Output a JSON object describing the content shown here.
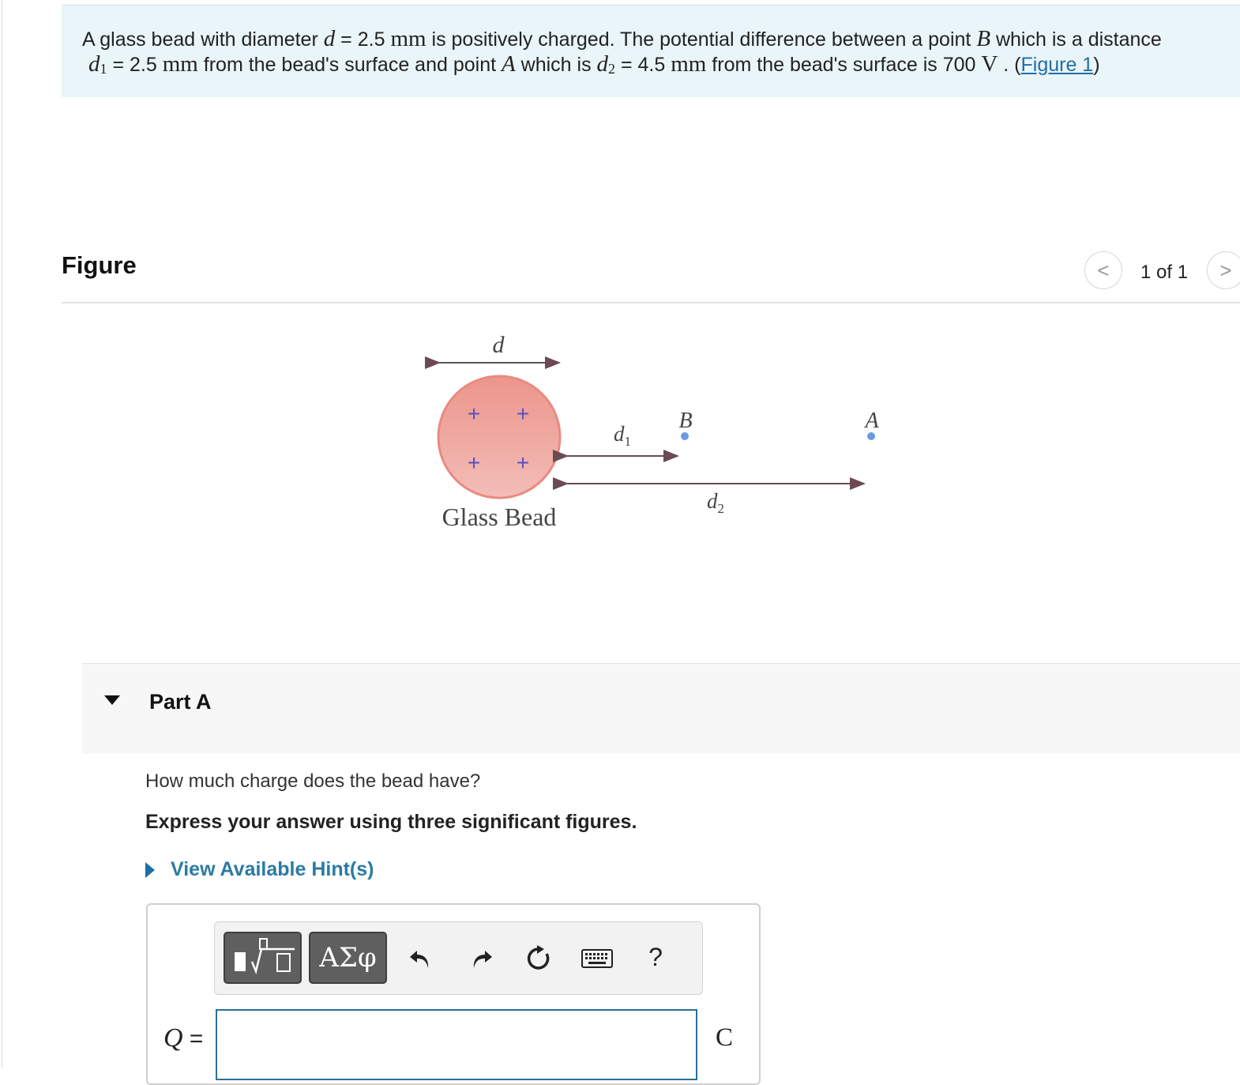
{
  "problem": {
    "p1": "A glass bead with diameter ",
    "d_sym": "d",
    "eq": " = 2.5 ",
    "mm": "mm",
    "p2": "  is positively charged. The potential difference between a point ",
    "B_sym": "B",
    "p3": " which is a distance",
    "d1_main": "d",
    "d1_sub": "1",
    "eq2": " = 2.5 ",
    "mm2": "mm",
    "p4": " from the bead's surface and point ",
    "A_sym": "A",
    "p5": " which is ",
    "d2_main": "d",
    "d2_sub": "2",
    "eq3": " = 4.5 ",
    "mm3": "mm",
    "p6": " from the bead's surface is 700 ",
    "V": "V",
    "p7": " . (",
    "figure_link": "Figure 1",
    "p8": ")"
  },
  "figure_panel": {
    "title": "Figure",
    "pager": "1 of 1",
    "prev_glyph": "<",
    "next_glyph": ">"
  },
  "diagram": {
    "d_label": "d",
    "plus": "+",
    "bead_label": "Glass Bead",
    "d1_label": "d",
    "d1_sub": "1",
    "d2_label": "d",
    "d2_sub": "2",
    "B_label": "B",
    "A_label": "A",
    "bead_fill": "#f0a8a0",
    "point_color": "#6a9be0",
    "plus_color": "#5b4fc4"
  },
  "part": {
    "title": "Part A",
    "question": "How much charge does the bead have?",
    "instruction": "Express your answer using three significant figures.",
    "hint_link": "View Available Hint(s)"
  },
  "toolbar": {
    "symbols_label": "ΑΣφ",
    "help_label": "?"
  },
  "answer": {
    "variable": "Q",
    "equals": " =",
    "value": "",
    "unit": "C"
  },
  "colors": {
    "problem_bg": "#e9f5f8",
    "link": "#1f6ea6",
    "input_border": "#2b6f9a"
  }
}
